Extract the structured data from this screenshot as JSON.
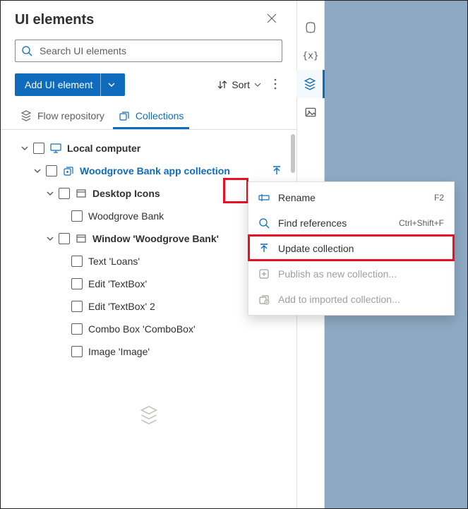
{
  "panel": {
    "title": "UI elements",
    "search_placeholder": "Search UI elements",
    "add_button": "Add UI element",
    "sort_label": "Sort",
    "tabs": {
      "flow_repo": "Flow repository",
      "collections": "Collections"
    }
  },
  "tree": {
    "root": "Local computer",
    "collection": "Woodgrove Bank app collection",
    "group_desktop": "Desktop Icons",
    "item_wb": "Woodgrove Bank",
    "group_window": "Window 'Woodgrove Bank'",
    "items": [
      "Text 'Loans'",
      "Edit 'TextBox'",
      "Edit 'TextBox' 2",
      "Combo Box 'ComboBox'",
      "Image 'Image'"
    ]
  },
  "menu": {
    "rename": {
      "label": "Rename",
      "shortcut": "F2"
    },
    "find": {
      "label": "Find references",
      "shortcut": "Ctrl+Shift+F"
    },
    "update": {
      "label": "Update collection"
    },
    "publish": {
      "label": "Publish as new collection..."
    },
    "add_imported": {
      "label": "Add to imported collection..."
    }
  },
  "strip_icons": [
    "copilot-icon",
    "variables-icon",
    "layers-icon",
    "images-icon"
  ],
  "colors": {
    "accent": "#0f6cbd",
    "danger": "#e81123"
  }
}
